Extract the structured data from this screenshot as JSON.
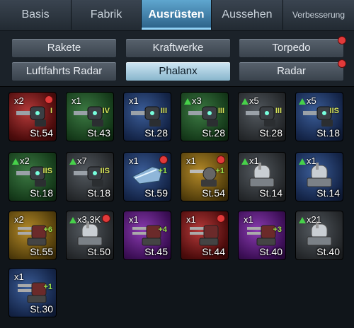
{
  "tabs": [
    {
      "label": "Basis",
      "active": false
    },
    {
      "label": "Fabrik",
      "active": false
    },
    {
      "label": "Ausrüsten",
      "active": true
    },
    {
      "label": "Aussehen",
      "active": false
    },
    {
      "label": "Verbesserung",
      "active": false
    }
  ],
  "categories": [
    {
      "label": "Rakete",
      "active": false,
      "alert": false
    },
    {
      "label": "Kraftwerke",
      "active": false,
      "alert": false
    },
    {
      "label": "Torpedo",
      "active": false,
      "alert": true
    },
    {
      "label": "Luftfahrts Radar",
      "active": false,
      "alert": false
    },
    {
      "label": "Phalanx",
      "active": true,
      "alert": false
    },
    {
      "label": "Radar",
      "active": false,
      "alert": true
    }
  ],
  "items": [
    {
      "count": "x2",
      "up": false,
      "badge": "I",
      "level": "St.54",
      "rarity": "red",
      "alert": true,
      "icon": "gatling-turret-icon"
    },
    {
      "count": "x1",
      "up": false,
      "badge": "IV",
      "level": "St.43",
      "rarity": "green",
      "alert": false,
      "icon": "gatling-turret-icon"
    },
    {
      "count": "x1",
      "up": false,
      "badge": "III",
      "level": "St.28",
      "rarity": "blue",
      "alert": false,
      "icon": "gatling-turret-icon"
    },
    {
      "count": "x3",
      "up": true,
      "badge": "III",
      "level": "St.28",
      "rarity": "green",
      "alert": false,
      "icon": "gatling-turret-icon"
    },
    {
      "count": "x5",
      "up": true,
      "badge": "III",
      "level": "St.28",
      "rarity": "grey",
      "alert": false,
      "icon": "gatling-turret-icon"
    },
    {
      "count": "x5",
      "up": true,
      "badge": "IIS",
      "level": "St.18",
      "rarity": "blue",
      "alert": false,
      "icon": "gatling-turret-icon"
    },
    {
      "count": "x2",
      "up": true,
      "badge": "IIS",
      "level": "St.18",
      "rarity": "green",
      "alert": false,
      "icon": "gatling-turret-icon"
    },
    {
      "count": "x7",
      "up": true,
      "badge": "IIS",
      "level": "St.18",
      "rarity": "grey",
      "alert": false,
      "icon": "gatling-turret-icon"
    },
    {
      "count": "x1",
      "up": false,
      "badge": "+1",
      "level": "St.59",
      "rarity": "blue",
      "alert": true,
      "icon": "laser-cannon-icon"
    },
    {
      "count": "x1",
      "up": false,
      "badge": "+1",
      "level": "St.54",
      "rarity": "gold",
      "alert": true,
      "icon": "radar-turret-icon"
    },
    {
      "count": "x1",
      "up": true,
      "badge": "",
      "level": "St.14",
      "rarity": "grey",
      "alert": false,
      "icon": "ciws-dome-icon"
    },
    {
      "count": "x1",
      "up": true,
      "badge": "",
      "level": "St.14",
      "rarity": "blue",
      "alert": false,
      "icon": "ciws-dome-icon"
    },
    {
      "count": "x2",
      "up": false,
      "badge": "+6",
      "level": "St.55",
      "rarity": "gold",
      "alert": false,
      "icon": "twin-gun-icon"
    },
    {
      "count": "x3.3K",
      "up": true,
      "badge": "",
      "level": "St.50",
      "rarity": "grey",
      "alert": true,
      "icon": "ciws-dome-icon"
    },
    {
      "count": "x1",
      "up": false,
      "badge": "+4",
      "level": "St.45",
      "rarity": "purple",
      "alert": false,
      "icon": "twin-gun-icon"
    },
    {
      "count": "x1",
      "up": false,
      "badge": "",
      "level": "St.44",
      "rarity": "red",
      "alert": true,
      "icon": "twin-gun-icon"
    },
    {
      "count": "x1",
      "up": false,
      "badge": "+3",
      "level": "St.40",
      "rarity": "purple",
      "alert": false,
      "icon": "twin-gun-icon"
    },
    {
      "count": "x21",
      "up": true,
      "badge": "",
      "level": "St.40",
      "rarity": "grey",
      "alert": false,
      "icon": "ciws-dome-icon"
    },
    {
      "count": "x1",
      "up": false,
      "badge": "+1",
      "level": "St.30",
      "rarity": "blue",
      "alert": false,
      "icon": "twin-gun-icon"
    }
  ]
}
